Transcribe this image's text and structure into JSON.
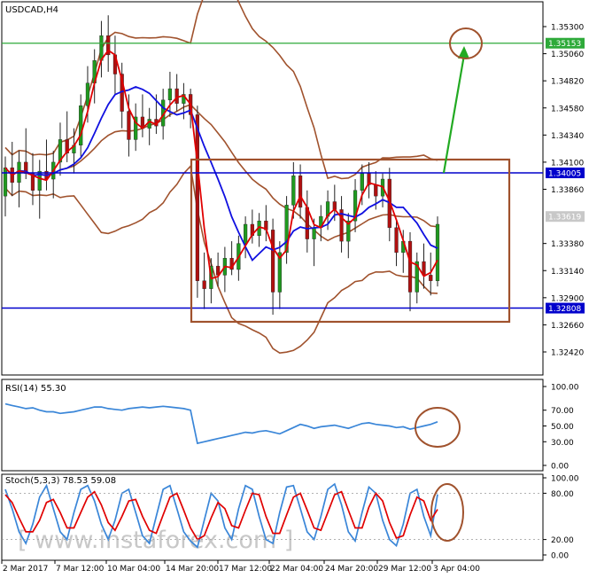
{
  "window": {
    "symbol_label": "USDCAD,H4",
    "watermark": "[ www.instaforex.com ]"
  },
  "colors": {
    "bull_candle": "#1f9a1f",
    "bear_candle": "#b01010",
    "bollinger": "#a0522d",
    "ma_fast": "#e00000",
    "ma_slow": "#1010e0",
    "resistance_line": "#0000cc",
    "target_line": "#2eaa3a",
    "box": "#a0522d",
    "arrow": "#22aa22",
    "rsi_line": "#3a86d8",
    "stoch_main": "#3a86d8",
    "stoch_signal": "#e00000",
    "price_tag": "#0000cc",
    "current_tag": "#c8c8c8",
    "target_tag": "#2eaa3a"
  },
  "chart_data": [
    {
      "type": "candlestick",
      "title": "USDCAD,H4",
      "ylim": [
        1.3222,
        1.3553
      ],
      "y_ticks": [
        "1.35300",
        "1.35060",
        "1.34820",
        "1.34580",
        "1.34340",
        "1.34100",
        "1.33860",
        "1.33380",
        "1.33140",
        "1.32900",
        "1.32660",
        "1.32420"
      ],
      "x_ticks": [
        "2 Mar 2017",
        "7 Mar 12:00",
        "10 Mar 04:00",
        "14 Mar 20:00",
        "17 Mar 12:00",
        "22 Mar 04:00",
        "24 Mar 20:00",
        "29 Mar 12:00",
        "3 Apr 04:00"
      ],
      "levels": [
        {
          "name": "target",
          "value": "1.35153"
        },
        {
          "name": "resistance",
          "value": "1.34005"
        },
        {
          "name": "current",
          "value": "1.33619"
        },
        {
          "name": "support",
          "value": "1.32808"
        }
      ],
      "candles": [
        [
          1.338,
          1.3415,
          1.3362,
          1.3405
        ],
        [
          1.3405,
          1.3428,
          1.338,
          1.3392
        ],
        [
          1.3392,
          1.342,
          1.337,
          1.341
        ],
        [
          1.341,
          1.344,
          1.3395,
          1.34
        ],
        [
          1.34,
          1.3418,
          1.3372,
          1.3385
        ],
        [
          1.3385,
          1.3412,
          1.336,
          1.3402
        ],
        [
          1.3402,
          1.343,
          1.3385,
          1.3395
        ],
        [
          1.3395,
          1.342,
          1.3378,
          1.341
        ],
        [
          1.341,
          1.3445,
          1.3398,
          1.343
        ],
        [
          1.343,
          1.3455,
          1.341,
          1.3418
        ],
        [
          1.3418,
          1.344,
          1.34,
          1.3425
        ],
        [
          1.3425,
          1.347,
          1.3415,
          1.346
        ],
        [
          1.346,
          1.3495,
          1.3445,
          1.348
        ],
        [
          1.348,
          1.351,
          1.3462,
          1.35
        ],
        [
          1.35,
          1.3535,
          1.3485,
          1.3522
        ],
        [
          1.3522,
          1.354,
          1.349,
          1.3505
        ],
        [
          1.3505,
          1.3522,
          1.347,
          1.3488
        ],
        [
          1.3488,
          1.3498,
          1.344,
          1.3455
        ],
        [
          1.3455,
          1.347,
          1.3415,
          1.343
        ],
        [
          1.343,
          1.3462,
          1.342,
          1.345
        ],
        [
          1.345,
          1.347,
          1.3432,
          1.344
        ],
        [
          1.344,
          1.3458,
          1.3425,
          1.3448
        ],
        [
          1.3448,
          1.347,
          1.3435,
          1.3442
        ],
        [
          1.3442,
          1.3475,
          1.343,
          1.3465
        ],
        [
          1.3465,
          1.349,
          1.345,
          1.3475
        ],
        [
          1.3475,
          1.3488,
          1.3455,
          1.3462
        ],
        [
          1.3462,
          1.348,
          1.3448,
          1.347
        ],
        [
          1.347,
          1.3475,
          1.344,
          1.3452
        ],
        [
          1.3452,
          1.346,
          1.329,
          1.3305
        ],
        [
          1.3305,
          1.333,
          1.328,
          1.3298
        ],
        [
          1.3298,
          1.3325,
          1.3285,
          1.3318
        ],
        [
          1.3318,
          1.333,
          1.33,
          1.331
        ],
        [
          1.331,
          1.3335,
          1.3295,
          1.3325
        ],
        [
          1.3325,
          1.334,
          1.331,
          1.3315
        ],
        [
          1.3315,
          1.3345,
          1.3305,
          1.3338
        ],
        [
          1.3338,
          1.3362,
          1.3325,
          1.3355
        ],
        [
          1.3355,
          1.3368,
          1.3338,
          1.3345
        ],
        [
          1.3345,
          1.3365,
          1.3335,
          1.3358
        ],
        [
          1.3358,
          1.3372,
          1.334,
          1.335
        ],
        [
          1.335,
          1.336,
          1.3275,
          1.3295
        ],
        [
          1.3295,
          1.334,
          1.328,
          1.333
        ],
        [
          1.333,
          1.338,
          1.332,
          1.3372
        ],
        [
          1.3372,
          1.341,
          1.336,
          1.3398
        ],
        [
          1.3398,
          1.3408,
          1.336,
          1.337
        ],
        [
          1.337,
          1.3385,
          1.333,
          1.3342
        ],
        [
          1.3342,
          1.336,
          1.3318,
          1.3352
        ],
        [
          1.3352,
          1.3372,
          1.334,
          1.3362
        ],
        [
          1.3362,
          1.3385,
          1.335,
          1.3375
        ],
        [
          1.3375,
          1.339,
          1.3358,
          1.3368
        ],
        [
          1.3368,
          1.338,
          1.333,
          1.334
        ],
        [
          1.334,
          1.3365,
          1.3325,
          1.3358
        ],
        [
          1.3358,
          1.3395,
          1.3348,
          1.3385
        ],
        [
          1.3385,
          1.3408,
          1.3372,
          1.34
        ],
        [
          1.34,
          1.341,
          1.3378,
          1.339
        ],
        [
          1.339,
          1.3402,
          1.3368,
          1.338
        ],
        [
          1.338,
          1.34,
          1.337,
          1.3395
        ],
        [
          1.3395,
          1.3405,
          1.334,
          1.3352
        ],
        [
          1.3352,
          1.336,
          1.3318,
          1.333
        ],
        [
          1.333,
          1.335,
          1.3312,
          1.334
        ],
        [
          1.334,
          1.3348,
          1.3278,
          1.3295
        ],
        [
          1.3295,
          1.333,
          1.3285,
          1.3322
        ],
        [
          1.3322,
          1.3338,
          1.3298,
          1.331
        ],
        [
          1.331,
          1.333,
          1.3292,
          1.3305
        ],
        [
          1.3305,
          1.3362,
          1.33,
          1.3355
        ]
      ]
    },
    {
      "type": "line",
      "title": "RSI(14) 55.30",
      "ylim": [
        0,
        100
      ],
      "y_ticks": [
        "100.00",
        "70.00",
        "50.00",
        "30.00",
        "0.00"
      ],
      "series": [
        {
          "values": [
            78,
            76,
            74,
            72,
            73,
            70,
            68,
            68,
            66,
            67,
            68,
            70,
            72,
            74,
            74,
            72,
            71,
            70,
            72,
            73,
            74,
            73,
            74,
            75,
            74,
            73,
            72,
            70,
            28,
            30,
            32,
            34,
            36,
            38,
            40,
            42,
            41,
            43,
            44,
            42,
            40,
            44,
            48,
            52,
            50,
            47,
            49,
            50,
            51,
            49,
            47,
            50,
            53,
            54,
            52,
            51,
            50,
            48,
            49,
            46,
            48,
            50,
            52,
            55.3
          ]
        }
      ]
    },
    {
      "type": "line",
      "title": "Stoch(5,3,3) 78.53 59.08",
      "ylim": [
        0,
        100
      ],
      "y_ticks": [
        "100.00",
        "80.00",
        "20.00",
        "0.00"
      ],
      "series": [
        {
          "values": [
            85,
            60,
            30,
            15,
            40,
            75,
            90,
            60,
            30,
            20,
            55,
            85,
            90,
            70,
            40,
            20,
            45,
            80,
            85,
            55,
            25,
            15,
            50,
            85,
            90,
            60,
            30,
            18,
            10,
            45,
            80,
            70,
            35,
            20,
            60,
            90,
            85,
            50,
            20,
            15,
            55,
            88,
            90,
            60,
            30,
            20,
            50,
            85,
            92,
            65,
            30,
            18,
            55,
            88,
            80,
            45,
            20,
            12,
            40,
            80,
            85,
            50,
            25,
            78.53
          ]
        },
        {
          "values": [
            78,
            68,
            48,
            30,
            30,
            45,
            68,
            72,
            55,
            35,
            35,
            55,
            75,
            82,
            65,
            42,
            32,
            50,
            70,
            72,
            50,
            32,
            28,
            52,
            75,
            80,
            58,
            35,
            20,
            25,
            48,
            68,
            60,
            38,
            35,
            58,
            80,
            78,
            50,
            28,
            28,
            52,
            75,
            80,
            58,
            35,
            32,
            55,
            78,
            82,
            58,
            35,
            35,
            62,
            80,
            70,
            42,
            22,
            25,
            52,
            75,
            70,
            45,
            59.08
          ]
        }
      ]
    }
  ]
}
